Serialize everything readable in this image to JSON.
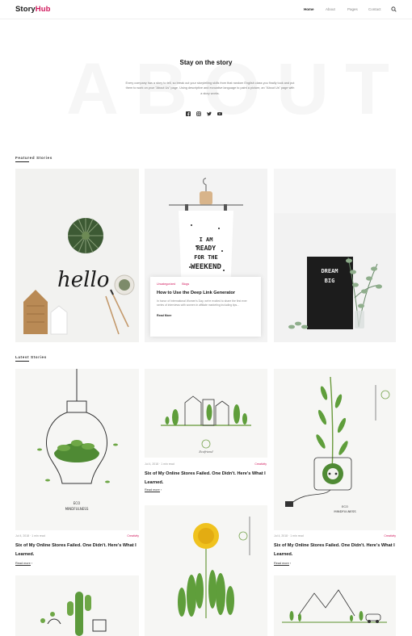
{
  "header": {
    "logo_main": "Story",
    "logo_accent": "Hub",
    "nav": [
      "Home",
      "About",
      "Pages",
      "Contact"
    ],
    "active_nav": "Home"
  },
  "hero": {
    "watermark": "ABOUT",
    "title": "Stay on the story",
    "text": "Every company has a story to tell, so break out your storytelling skills from that random English class you finally took and put them to work on your \"About Us\" page. Using descriptive and evocative language to paint a picture, an \"About Us\" page with a story works.",
    "socials": [
      "facebook-icon",
      "instagram-icon",
      "twitter-icon",
      "youtube-icon"
    ]
  },
  "featured": {
    "heading": "Featured Stories",
    "overlay": {
      "tags": [
        "Uncategorized",
        "Blogs"
      ],
      "title": "How to Use the Deep Link Generator",
      "text": "In honor of International Women's Day, we're excited to share the first ever series of interviews with women in affiliate marketing including tips...",
      "read_more": "Read More"
    },
    "letter_board": [
      "DREAM",
      "BIG"
    ],
    "shirt_text": [
      "I AM",
      "READY",
      "FOR THE",
      "WEEKEND"
    ],
    "hello_text": "hello"
  },
  "latest": {
    "heading": "Latest Stories",
    "posts": [
      {
        "meta": "Jul 4, 2018 · 1 min read",
        "category": "Creativity",
        "title": "Six of My Online Stores Failed. One Didn't. Here's What I Learned.",
        "read_more": "Read more",
        "art_text": [
          "ECO",
          "MINDFULNESS"
        ]
      },
      {
        "meta": "Jul 4, 2018 · 1 min read",
        "category": "Creativity",
        "title": "Six of My Online Stores Failed. One Didn't. Here's What I Learned.",
        "read_more": "Read more",
        "art_text": [
          "Ecofriend"
        ]
      },
      {
        "meta": "Jul 4, 2018 · 1 min read",
        "category": "Creativity",
        "title": "Six of My Online Stores Failed. One Didn't. Here's What I Learned.",
        "read_more": "Read more",
        "art_text": [
          "ECO",
          "MINDFULNESS"
        ]
      }
    ]
  },
  "colors": {
    "accent": "#d1185c",
    "leaf": "#5f9e3b",
    "dark": "#1a1a1a"
  }
}
